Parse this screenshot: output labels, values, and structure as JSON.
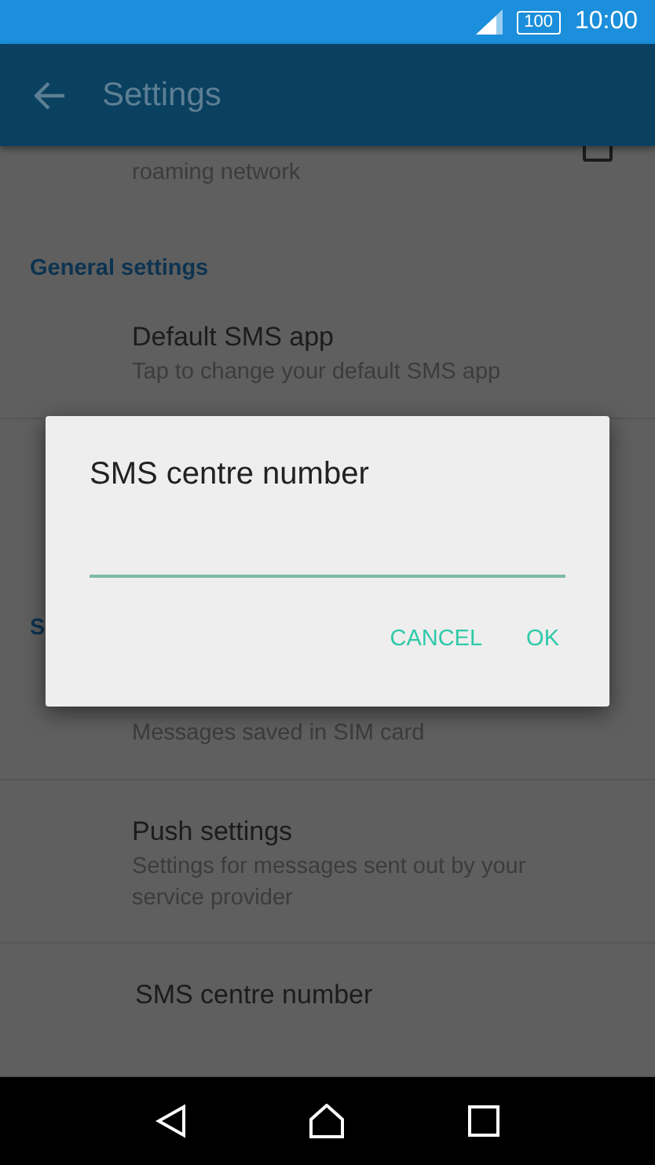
{
  "status_bar": {
    "battery": "100",
    "time": "10:00"
  },
  "app_bar": {
    "title": "Settings"
  },
  "list": [
    {
      "kind": "setting",
      "subtitle": "roaming network",
      "checkbox": {
        "checked": false
      }
    },
    {
      "kind": "header",
      "label": "General settings"
    },
    {
      "kind": "setting",
      "title": "Default SMS app",
      "subtitle": "Tap to change your default SMS app"
    },
    {
      "kind": "covered"
    },
    {
      "kind": "header",
      "label": "S"
    },
    {
      "kind": "setting",
      "subtitle": "Messages saved in SIM card"
    },
    {
      "kind": "setting",
      "title": "Push settings",
      "subtitle": "Settings for messages sent out by your\nservice provider"
    },
    {
      "kind": "setting",
      "title": "SMS centre number"
    }
  ],
  "dialog": {
    "title": "SMS centre number",
    "buttons": [
      "CANCEL",
      "OK"
    ]
  }
}
